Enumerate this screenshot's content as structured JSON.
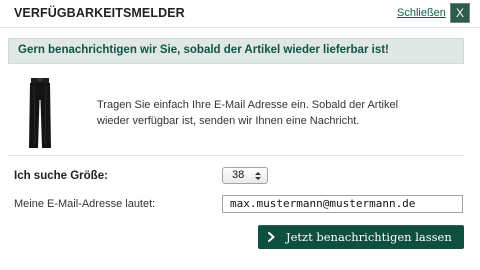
{
  "header": {
    "title": "VERFÜGBARKEITSMELDER",
    "close_link": "Schließen",
    "close_button": "X"
  },
  "notice": {
    "text": "Gern benachrichtigen wir Sie, sobald der Artikel wieder lieferbar ist!"
  },
  "product": {
    "image_icon": "trousers-icon"
  },
  "info": {
    "line1": "Tragen Sie einfach Ihre E-Mail Adresse ein. Sobald der Artikel",
    "line2": "wieder verfügbar ist, senden wir Ihnen eine Nachricht."
  },
  "form": {
    "size_label": "Ich suche Größe:",
    "size_value": "38",
    "email_label": "Meine E-Mail-Adresse lautet:",
    "email_value": "max.mustermann@mustermann.de",
    "submit_label": "Jetzt benachrichtigen lassen"
  },
  "colors": {
    "accent": "#0f4f3d",
    "notice_bg": "#e1e7e5",
    "link": "#0d5e49"
  }
}
